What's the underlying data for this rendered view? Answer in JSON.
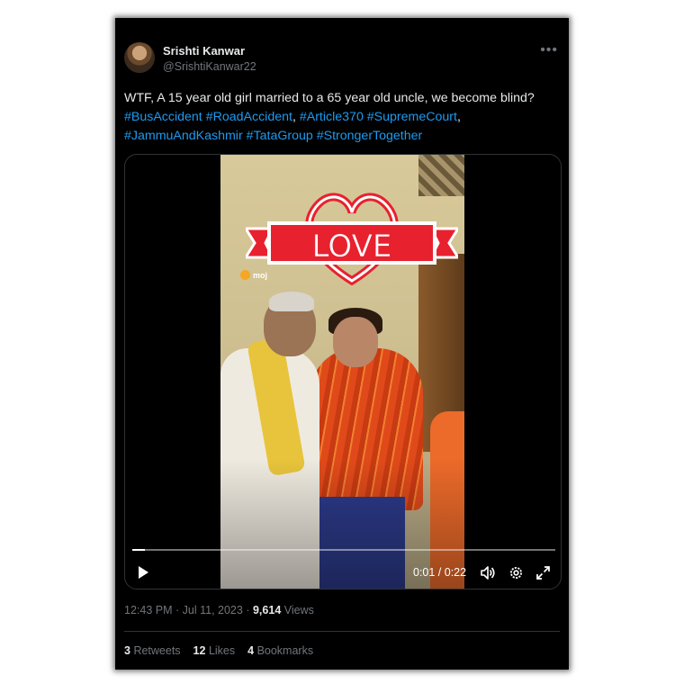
{
  "author": {
    "name": "Srishti Kanwar",
    "handle": "@SrishtiKanwar22"
  },
  "tweet": {
    "text_line1": "WTF, A 15 year old girl married to a 65 year old uncle, we become blind?",
    "hashtags_line2": [
      "#BusAccident",
      "#RoadAccident",
      "#Article370",
      "#SupremeCourt"
    ],
    "hashtags_line3": [
      "#JammuAndKashmir",
      "#TataGroup",
      "#StrongerTogether"
    ],
    "separator_comma": ","
  },
  "video": {
    "overlay_text": "LOVE",
    "watermark": "moj",
    "time_display": "0:01 / 0:22",
    "progress": 0.03,
    "icons": [
      "play-icon",
      "volume-icon",
      "gear-icon",
      "expand-icon"
    ]
  },
  "meta": {
    "time": "12:43 PM",
    "date": "Jul 11, 2023",
    "views_count": "9,614",
    "views_label": "Views",
    "separator": "·"
  },
  "stats": {
    "retweets_count": "3",
    "retweets_label": "Retweets",
    "likes_count": "12",
    "likes_label": "Likes",
    "bookmarks_count": "4",
    "bookmarks_label": "Bookmarks"
  },
  "colors": {
    "background": "#000000",
    "text": "#e7e9ea",
    "secondary": "#71767b",
    "link": "#1d9bf0",
    "love_red": "#e8212e"
  }
}
